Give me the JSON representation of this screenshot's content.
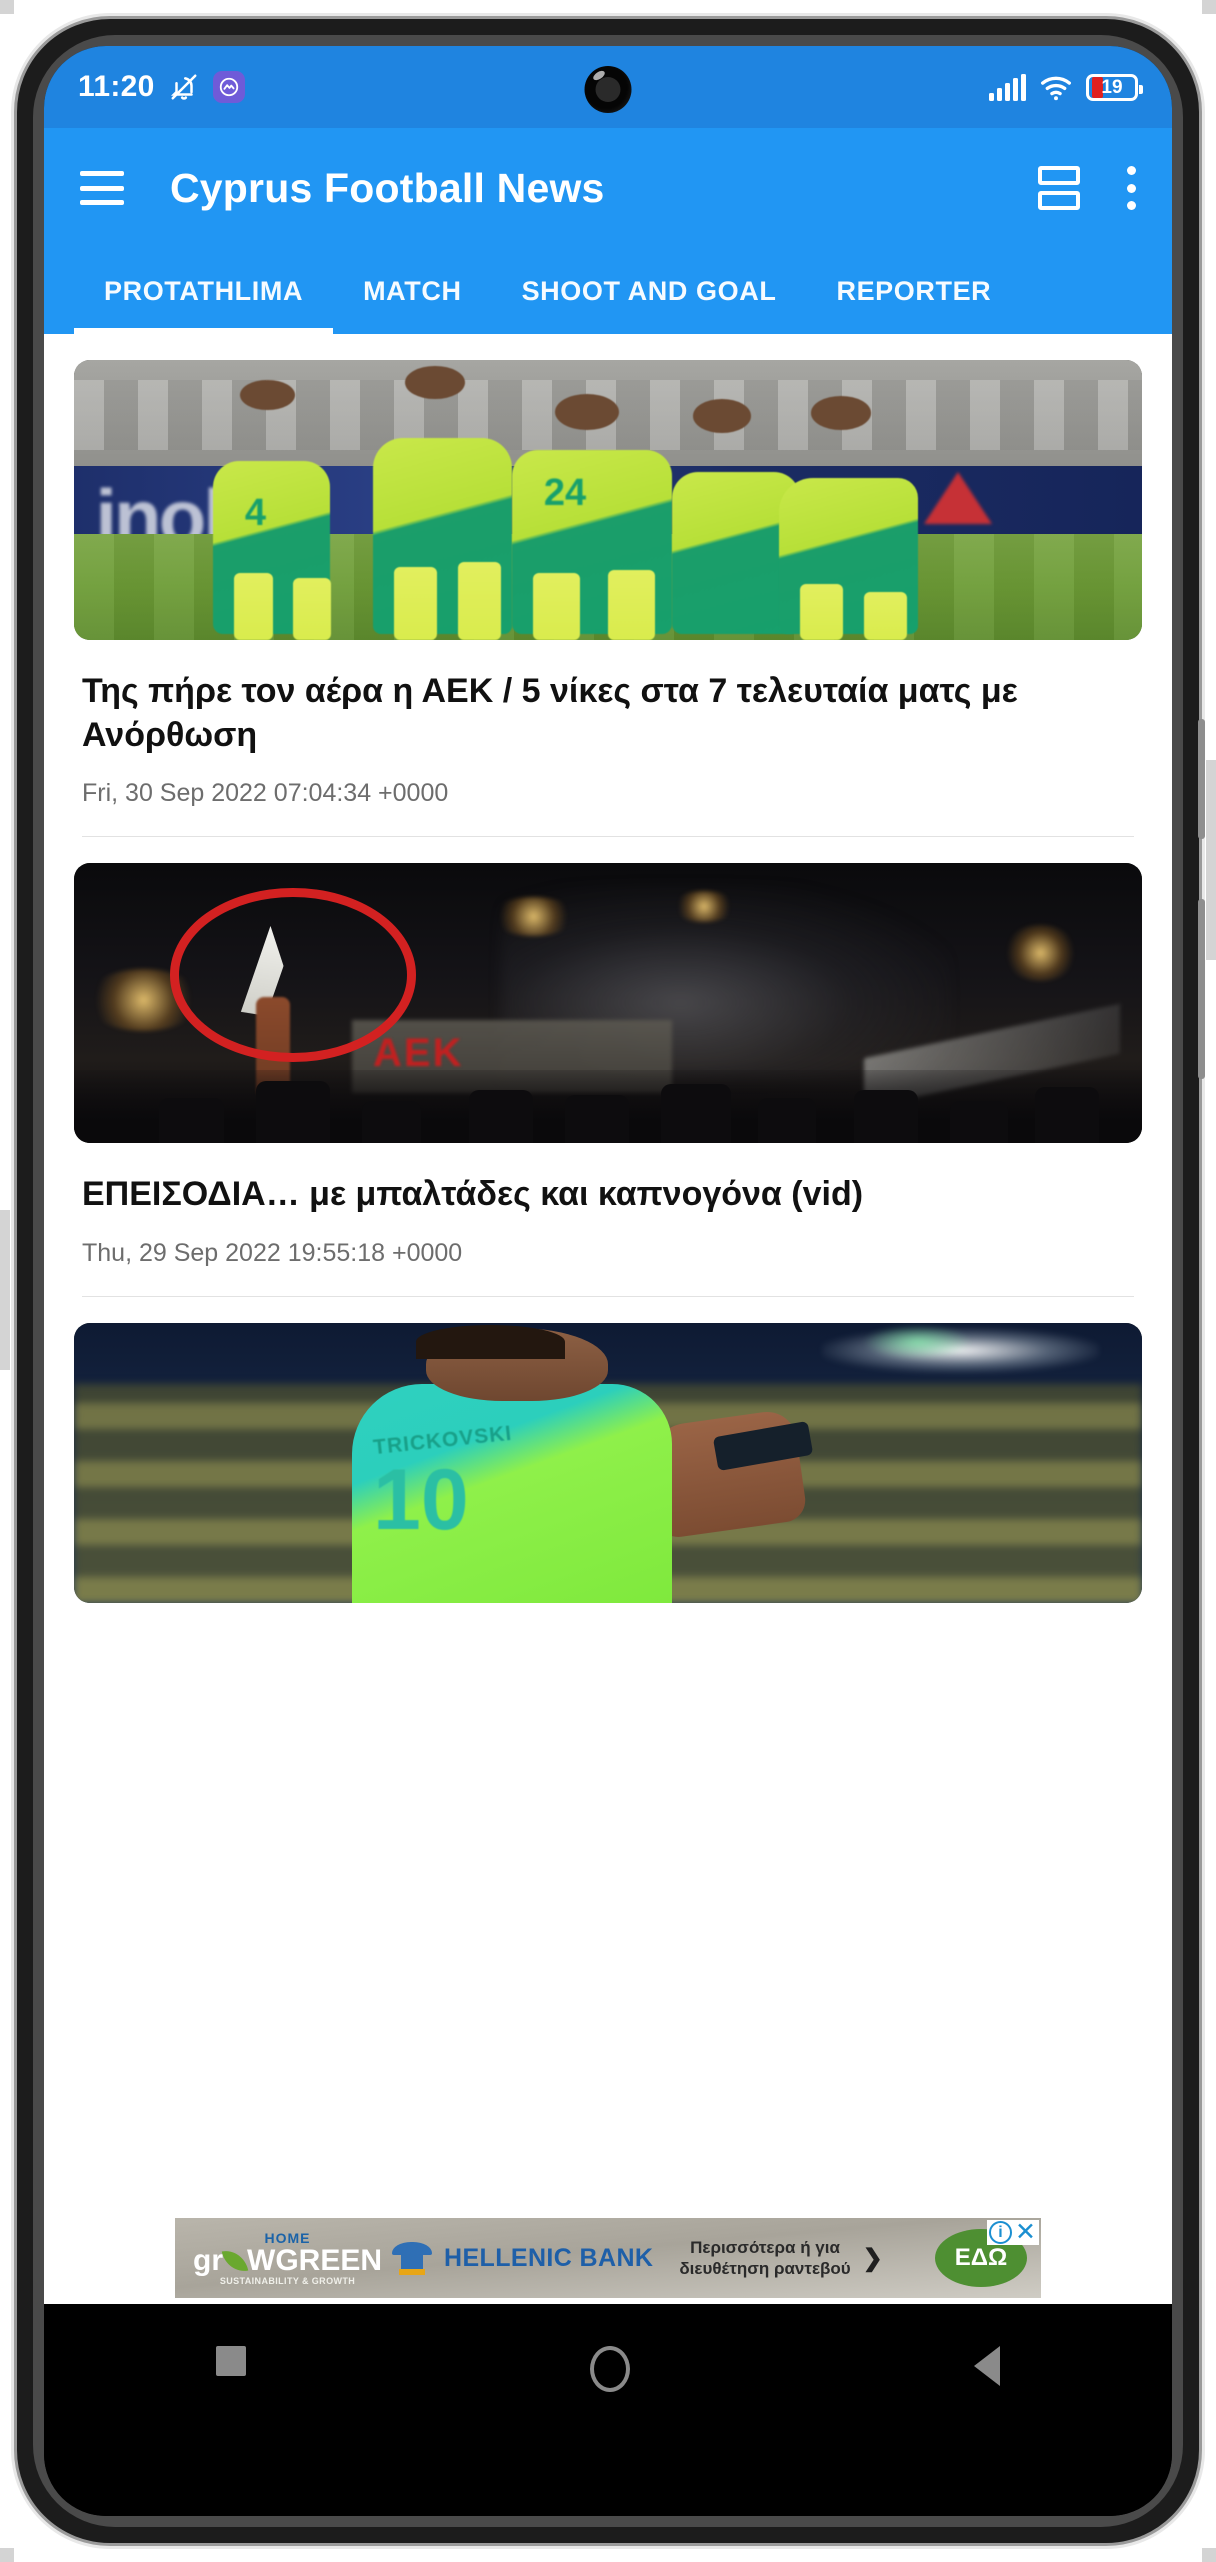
{
  "status_bar": {
    "time": "11:20",
    "notification_icon": "bell-off-icon",
    "app_badge_icon": "coinmarketcap-app-icon",
    "signal_icon": "cellular-signal-icon",
    "wifi_icon": "wifi-icon",
    "battery_level": "19",
    "battery_icon": "battery-low-icon"
  },
  "app_bar": {
    "menu_icon": "hamburger-menu-icon",
    "title": "Cyprus Football News",
    "view_toggle_icon": "layout-toggle-icon",
    "overflow_icon": "more-vertical-icon"
  },
  "tabs": [
    {
      "label": "PROTATHLIMA",
      "active": true
    },
    {
      "label": "MATCH",
      "active": false
    },
    {
      "label": "SHOOT AND GOAL",
      "active": false
    },
    {
      "label": "REPORTER",
      "active": false
    }
  ],
  "articles": [
    {
      "title": "Της πήρε τον αέρα η ΑΕΚ / 5 νίκες στα 7 τελευταία ματς με Ανόρθωση",
      "date": "Fri, 30 Sep 2022 07:04:34 +0000",
      "thumb_alt": "football-players-celebrating-photo"
    },
    {
      "title": "ΕΠΕΙΣΟΔΙΑ… με μπαλτάδες και καπνογόνα (vid)",
      "date": "Thu, 29 Sep 2022 19:55:18 +0000",
      "thumb_alt": "night-incident-video-still"
    },
    {
      "title": "",
      "date": "",
      "thumb_alt": "player-number-10-celebrating-photo"
    }
  ],
  "ad": {
    "brand_top": "HOME",
    "brand_main_prefix": "gr",
    "brand_main_suffix": "WGREEN",
    "brand_sub": "SUSTAINABILITY & GROWTH",
    "bank_name": "HELLENIC BANK",
    "bank_icon": "greek-column-icon",
    "copy_line1": "Περισσότερα ή για",
    "copy_line2": "διευθέτηση ραντεβού",
    "chevron": "❯",
    "cta_label": "ΕΔΩ",
    "info_icon": "ad-info-icon",
    "info_glyph": "i",
    "close_icon": "ad-close-icon",
    "close_glyph": "✕"
  },
  "nav_bar": {
    "recents_icon": "recents-square-icon",
    "home_icon": "home-circle-icon",
    "back_icon": "back-triangle-icon"
  },
  "photo3_jersey": {
    "name": "TRICKOVSKI",
    "number": "10"
  },
  "photo1_board": {
    "text": "inokda",
    "jersey_number": "4"
  },
  "photo2_overlay": {
    "text": "AEK"
  },
  "colors": {
    "status_bar": "#1f84e0",
    "app_bar": "#2196f3",
    "accent": "#2196f3",
    "battery_low": "#e02020",
    "ad_cta": "#4e8f32"
  }
}
